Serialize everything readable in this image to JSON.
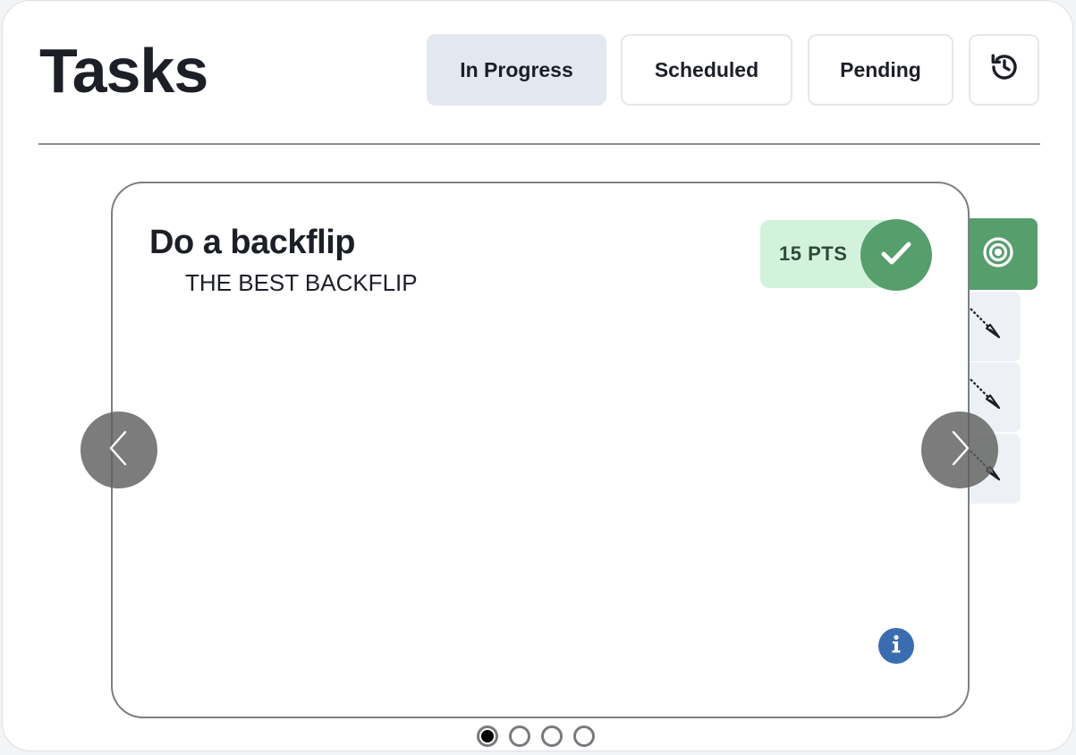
{
  "header": {
    "title": "Tasks",
    "tabs": [
      {
        "label": "In Progress",
        "active": true
      },
      {
        "label": "Scheduled",
        "active": false
      },
      {
        "label": "Pending",
        "active": false
      }
    ],
    "history_icon": "history-icon"
  },
  "task": {
    "title": "Do a backflip",
    "subtitle": "THE BEST BACKFLIP",
    "points": "15 PTS",
    "complete_icon": "checkmark-icon",
    "info_icon": "info-icon"
  },
  "side_actions": {
    "icons": [
      "target-icon",
      "arrow-icon",
      "arrow-icon",
      "arrow-icon"
    ]
  },
  "carousel": {
    "prev_icon": "chevron-left-icon",
    "next_icon": "chevron-right-icon",
    "page_count": 4,
    "active_index": 0
  },
  "colors": {
    "primary_green": "#579e6d",
    "points_bg": "#d3f2dc",
    "active_tab_bg": "#e3e7ef",
    "info_blue": "#3a6db0"
  }
}
